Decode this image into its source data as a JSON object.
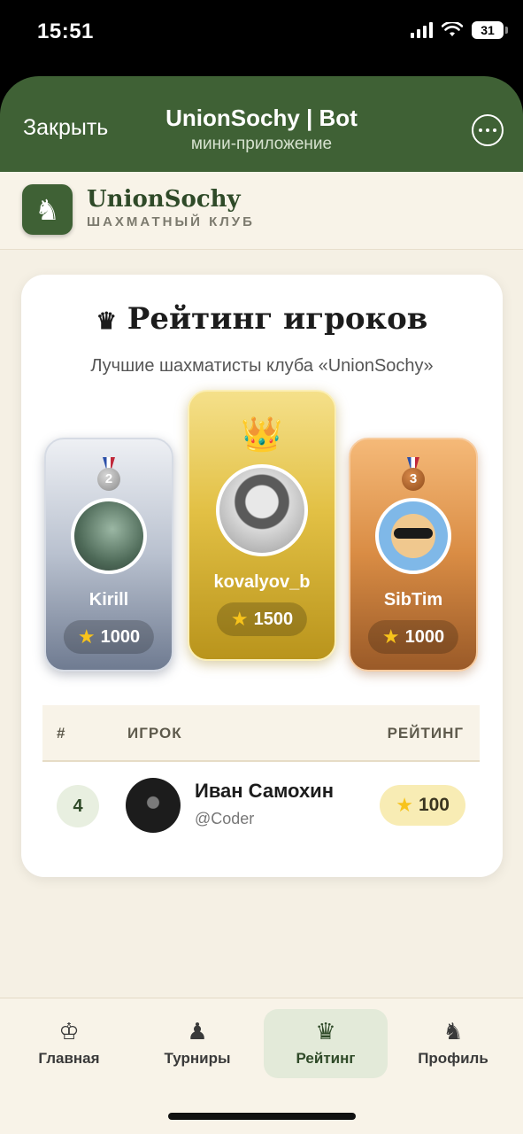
{
  "status_bar": {
    "time": "15:51",
    "battery": "31"
  },
  "header": {
    "close_label": "Закрыть",
    "title": "UnionSochy | Bot",
    "subtitle": "мини-приложение"
  },
  "club": {
    "name": "UnionSochy",
    "subtitle": "ШАХМАТНЫЙ КЛУБ",
    "logo_icon": "knight-icon"
  },
  "rating": {
    "title_icon": "♛",
    "title": "Рейтинг игроков",
    "subtitle": "Лучшие шахматисты клуба «UnionSochy»",
    "podium": [
      {
        "place": "2",
        "name": "Kirill",
        "score": "1000",
        "medal_color": "#a8a8a8"
      },
      {
        "place": "1",
        "name": "kovalyov_b",
        "score": "1500",
        "crown": "👑"
      },
      {
        "place": "3",
        "name": "SibTim",
        "score": "1000",
        "medal_color": "#b56a2c"
      }
    ],
    "table": {
      "headers": {
        "num": "#",
        "player": "ИГРОК",
        "rating": "РЕЙТИНГ"
      },
      "rows": [
        {
          "rank": "4",
          "name": "Иван Самохин",
          "handle": "@Coder",
          "score": "100"
        }
      ]
    }
  },
  "nav": {
    "items": [
      {
        "label": "Главная",
        "icon": "♔"
      },
      {
        "label": "Турниры",
        "icon": "♟"
      },
      {
        "label": "Рейтинг",
        "icon": "♛"
      },
      {
        "label": "Профиль",
        "icon": "♞"
      }
    ],
    "active": "Рейтинг"
  },
  "colors": {
    "brand_green": "#3f6135",
    "gold": "#e2c044",
    "silver": "#b9c1cf",
    "bronze": "#d98c44",
    "background": "#f5f0e4"
  }
}
